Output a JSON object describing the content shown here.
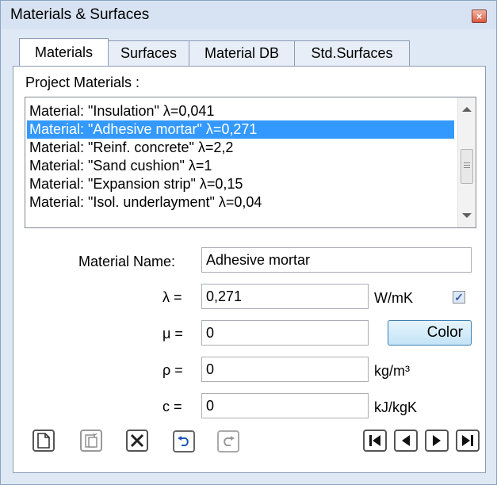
{
  "window": {
    "title": "Materials & Surfaces",
    "close_glyph": "×"
  },
  "tabs": [
    {
      "label": "Materials",
      "active": true
    },
    {
      "label": "Surfaces",
      "active": false
    },
    {
      "label": "Material DB",
      "active": false
    },
    {
      "label": "Std.Surfaces",
      "active": false
    }
  ],
  "project_materials": {
    "label": "Project Materials :",
    "items": [
      "Material: \"Insulation\" λ=0,041",
      "Material: \"Adhesive mortar\" λ=0,271",
      "Material: \"Reinf. concrete\" λ=2,2",
      "Material: \"Sand cushion\" λ=1",
      "Material: \"Expansion strip\" λ=0,15",
      "Material: \"Isol. underlayment\" λ=0,04"
    ],
    "selected_index": 1
  },
  "form": {
    "name_label": "Material Name:",
    "name_value": "Adhesive mortar",
    "lambda_label": "λ =",
    "lambda_value": "0,271",
    "lambda_unit": "W/mK",
    "lambda_checked": true,
    "mu_label": "μ =",
    "mu_value": "0",
    "color_button": "Color",
    "rho_label": "ρ =",
    "rho_value": "0",
    "rho_unit": "kg/m³",
    "c_label": "c =",
    "c_value": "0",
    "c_unit": "kJ/kgK"
  },
  "toolbar": {
    "icons": [
      "new-icon",
      "paste-icon",
      "delete-icon",
      "undo-icon",
      "redo-icon",
      "first-record-icon",
      "previous-record-icon",
      "next-record-icon",
      "last-record-icon"
    ]
  },
  "colors": {
    "selection": "#3399ff",
    "window_bg": "#dfe8f5",
    "accent_button": "#c3e4f7"
  }
}
